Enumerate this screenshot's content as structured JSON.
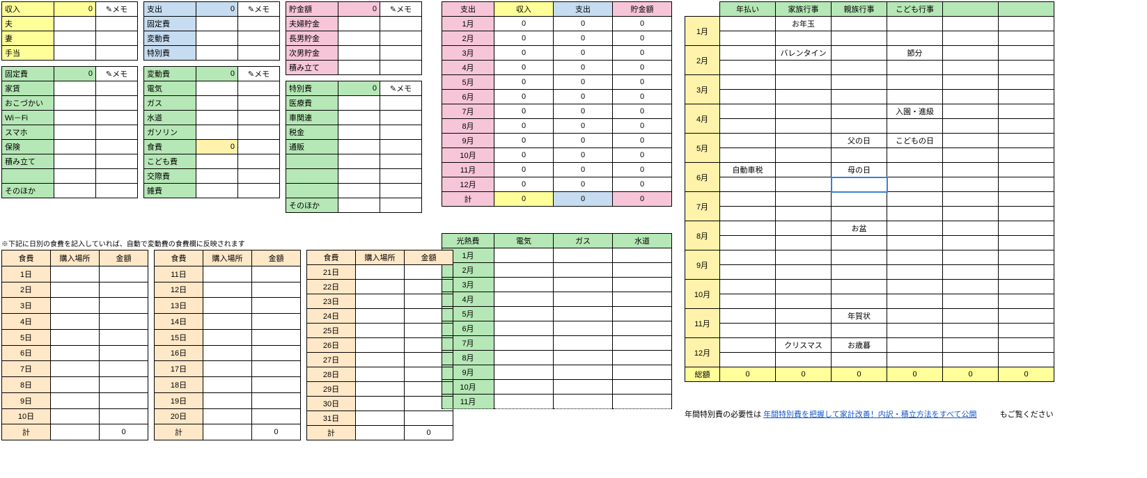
{
  "h": {
    "income": "収入",
    "expense": "支出",
    "savings": "貯金額",
    "memo": "✎メモ",
    "fixed": "固定費",
    "variable": "変動費",
    "special": "特別費",
    "food": "食費",
    "place": "購入場所",
    "amount": "金額",
    "total": "計",
    "utility": "光熱費",
    "elec": "電気",
    "gas": "ガス",
    "water": "水道",
    "annual": "年払い",
    "family": "家族行事",
    "relative": "親族行事",
    "child": "こども行事",
    "grand": "総額",
    "other": "そのほか"
  },
  "income": {
    "rows": [
      "夫",
      "妻",
      "手当"
    ]
  },
  "expense": {
    "rows": [
      "固定費",
      "変動費",
      "特別費"
    ]
  },
  "savings": {
    "rows": [
      "夫婦貯金",
      "長男貯金",
      "次男貯金",
      "積み立て"
    ]
  },
  "fixed": {
    "rows": [
      "家賃",
      "おこづかい",
      "Wi－Fi",
      "スマホ",
      "保険",
      "積み立て",
      "",
      "そのほか"
    ]
  },
  "variable": {
    "rows": [
      "電気",
      "ガス",
      "水道",
      "ガソリン",
      "食費",
      "こども費",
      "交際費",
      "雑費"
    ]
  },
  "special": {
    "rows": [
      "医療費",
      "車関連",
      "税金",
      "通販",
      "",
      "",
      "",
      "そのほか"
    ]
  },
  "months": [
    "1月",
    "2月",
    "3月",
    "4月",
    "5月",
    "6月",
    "7月",
    "8月",
    "9月",
    "10月",
    "11月",
    "12月"
  ],
  "days1": [
    "1日",
    "2日",
    "3日",
    "4日",
    "5日",
    "6日",
    "7日",
    "8日",
    "9日",
    "10日"
  ],
  "days2": [
    "11日",
    "12日",
    "13日",
    "14日",
    "15日",
    "16日",
    "17日",
    "18日",
    "19日",
    "20日"
  ],
  "days3": [
    "21日",
    "22日",
    "23日",
    "24日",
    "25日",
    "26日",
    "27日",
    "28日",
    "29日",
    "30日",
    "31日"
  ],
  "foodval": "0",
  "foodnote": "※下記に日別の食費を記入していれば、自動で変動費の食費欄に反映されます",
  "events": {
    "1": {
      "family": "お年玉"
    },
    "2": {
      "family": "バレンタイン",
      "child": "節分"
    },
    "4": {
      "child": "入園・進級"
    },
    "5": {
      "relative": "父の日",
      "child": "こどもの日"
    },
    "6": {
      "annual": "自動車税",
      "relative": "母の日"
    },
    "8": {
      "relative": "お盆"
    },
    "11": {
      "relative": "年賀状"
    },
    "12": {
      "family": "クリスマス",
      "relative": "お歳暮"
    }
  },
  "footer": {
    "pre": "年間特別費の必要性は",
    "link": "年間特別費を把握して家計改善！内訳・積立方法をすべて公開",
    "post": "もご覧ください"
  },
  "zero": "0"
}
